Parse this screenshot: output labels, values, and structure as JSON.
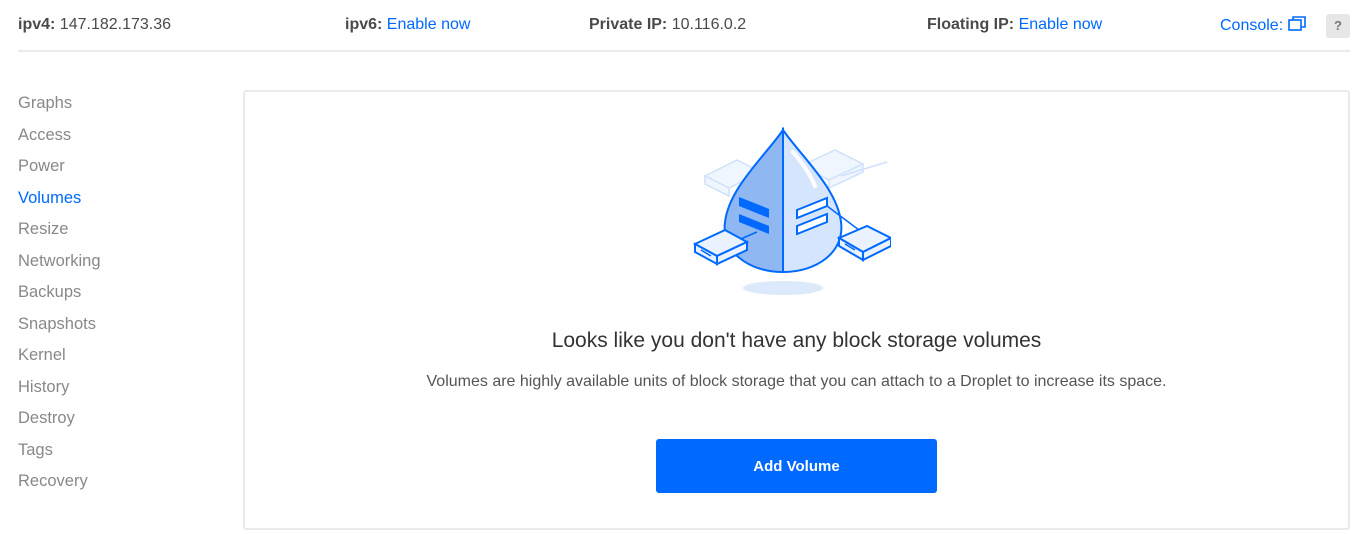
{
  "topbar": {
    "ipv4_label": "ipv4:",
    "ipv4_value": "147.182.173.36",
    "ipv6_label": "ipv6:",
    "ipv6_link": "Enable now",
    "private_label": "Private IP:",
    "private_value": "10.116.0.2",
    "floating_label": "Floating IP:",
    "floating_link": "Enable now",
    "console_label": "Console:",
    "help_label": "?"
  },
  "sidebar": {
    "items": [
      {
        "label": "Graphs"
      },
      {
        "label": "Access"
      },
      {
        "label": "Power"
      },
      {
        "label": "Volumes",
        "active": true
      },
      {
        "label": "Resize"
      },
      {
        "label": "Networking"
      },
      {
        "label": "Backups"
      },
      {
        "label": "Snapshots"
      },
      {
        "label": "Kernel"
      },
      {
        "label": "History"
      },
      {
        "label": "Destroy"
      },
      {
        "label": "Tags"
      },
      {
        "label": "Recovery"
      }
    ]
  },
  "main": {
    "empty_title": "Looks like you don't have any block storage volumes",
    "empty_description": "Volumes are highly available units of block storage that you can attach to a Droplet to increase its space.",
    "add_button": "Add Volume",
    "illustration_icon": "storage-droplet-icon"
  },
  "colors": {
    "accent": "#0069ff",
    "muted_text": "#888888",
    "border": "#eaeaea"
  }
}
